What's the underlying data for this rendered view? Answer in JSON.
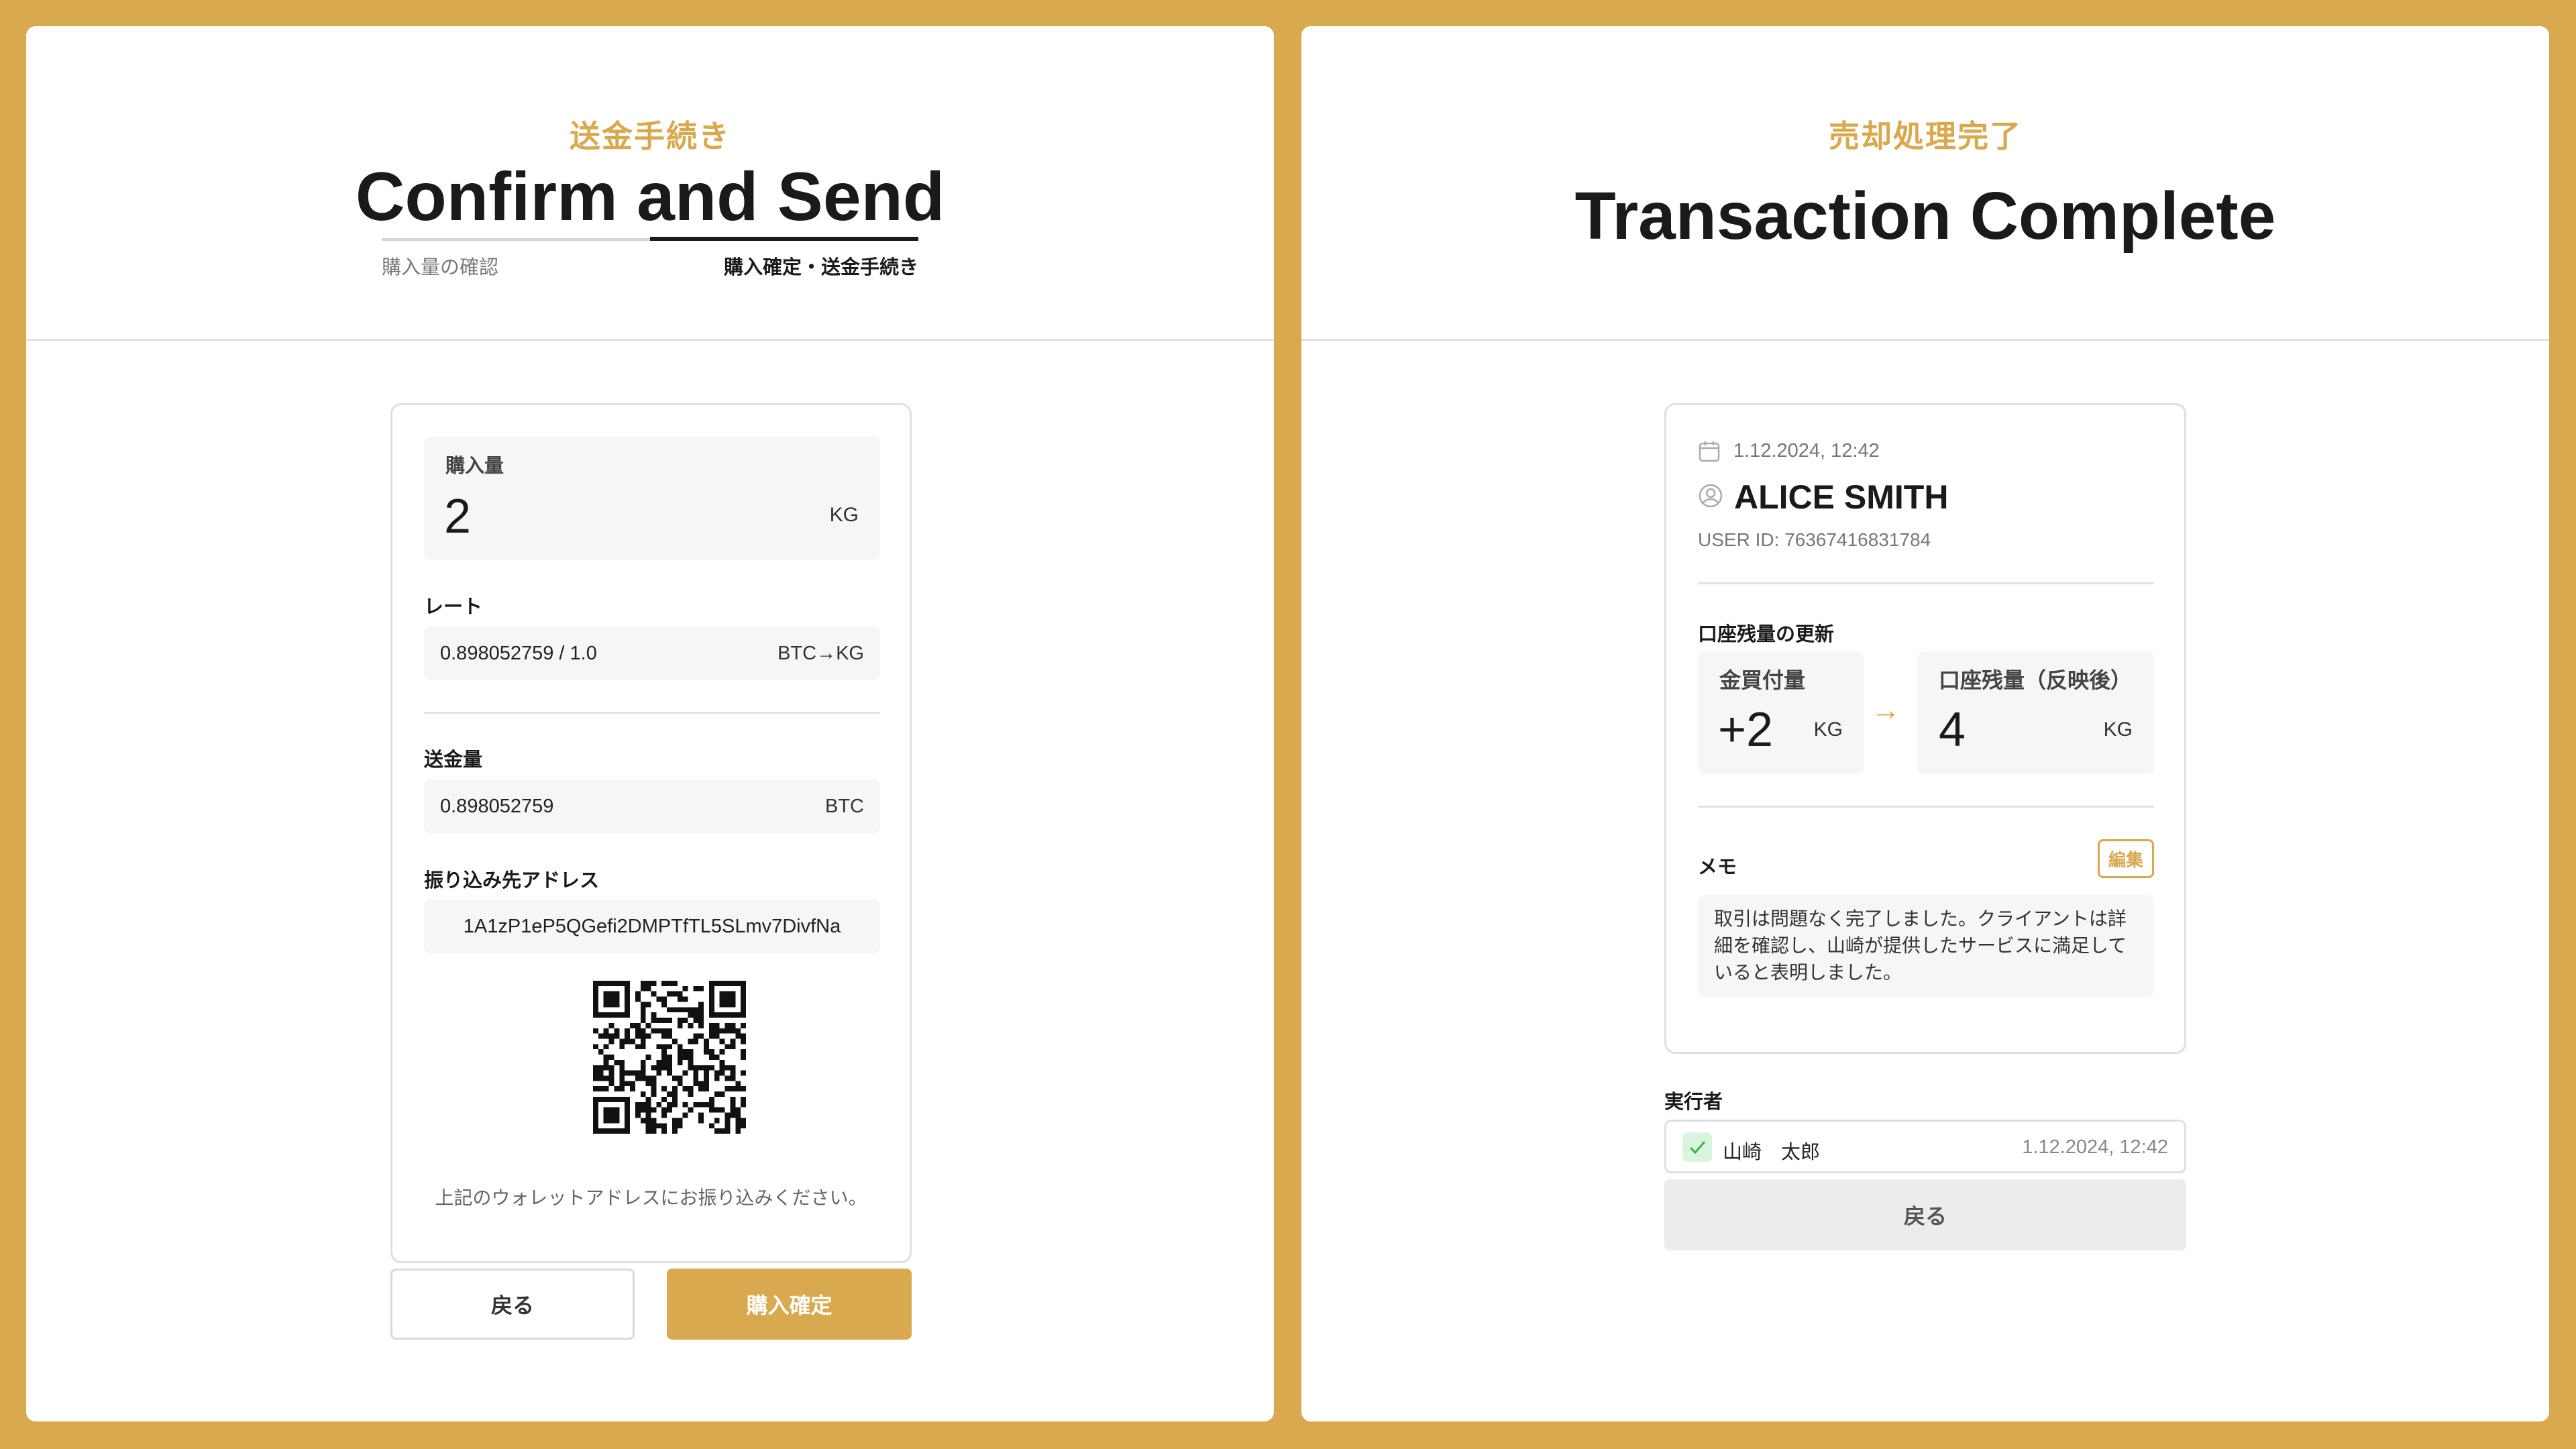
{
  "left": {
    "kicker": "送金手続き",
    "title": "Confirm and Send",
    "steps": [
      "購入量の確認",
      "購入確定・送金手続き"
    ],
    "purchase": {
      "label": "購入量",
      "value": "2",
      "unit": "KG"
    },
    "rate": {
      "label": "レート",
      "value": "0.898052759 / 1.0",
      "unit": "BTC→KG"
    },
    "send": {
      "label": "送金量",
      "value": "0.898052759",
      "unit": "BTC"
    },
    "address": {
      "label": "振り込み先アドレス",
      "value": "1A1zP1eP5QGefi2DMPTfTL5SLmv7DivfNa"
    },
    "qr_note": "上記のウォレットアドレスにお振り込みください。",
    "buttons": {
      "back": "戻る",
      "confirm": "購入確定"
    }
  },
  "right": {
    "kicker": "売却処理完了",
    "title": "Transaction Complete",
    "date": "1.12.2024, 12:42",
    "user_name": "ALICE SMITH",
    "user_id": "USER ID: 76367416831784",
    "balance_section": "口座残量の更新",
    "bought": {
      "label": "金買付量",
      "value": "+2",
      "unit": "KG"
    },
    "balance": {
      "label": "口座残量（反映後）",
      "value": "4",
      "unit": "KG"
    },
    "memo": {
      "label": "メモ",
      "edit": "編集",
      "lines": [
        "取引は問題なく完了しました。クライアントは詳",
        "細を確認し、山崎が提供したサービスに満足して",
        "いると表明しました。"
      ]
    },
    "executor": {
      "label": "実行者",
      "name": "山崎　太郎",
      "time": "1.12.2024, 12:42"
    },
    "back": "戻る"
  },
  "colors": {
    "accent": "#D8A94E",
    "check_bg": "#d9f5df",
    "check": "#3bb24f"
  }
}
